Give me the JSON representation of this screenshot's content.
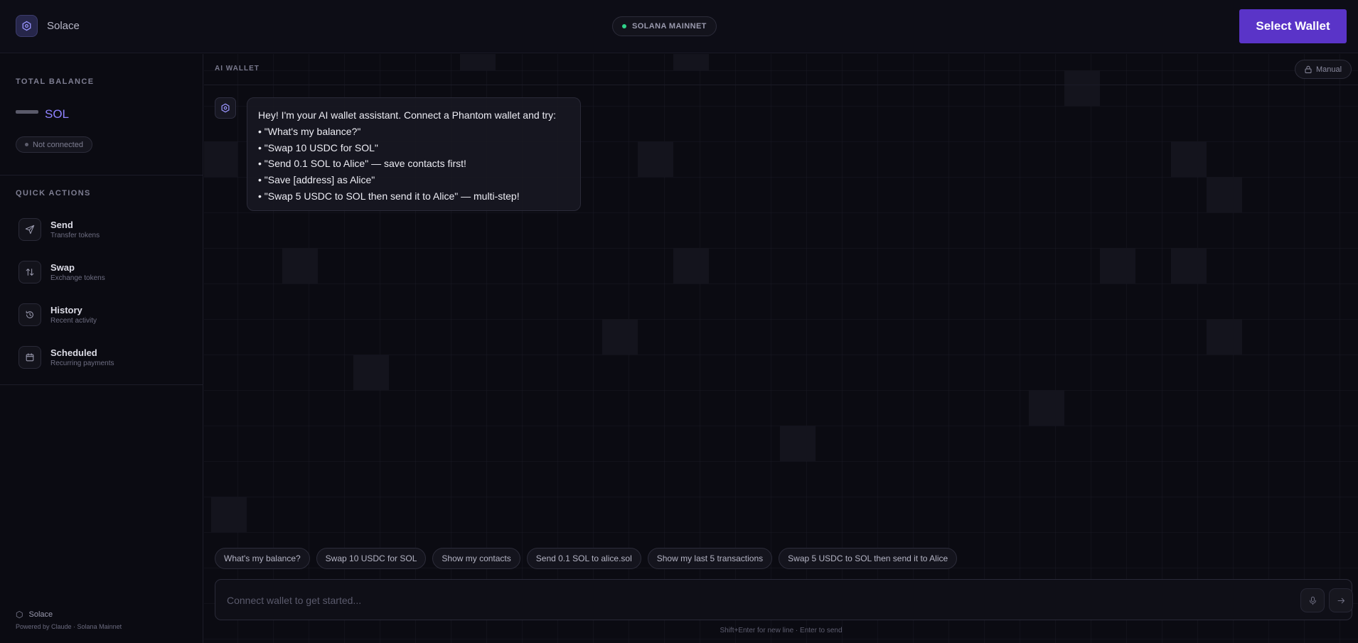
{
  "header": {
    "brand_name": "Solace",
    "network_label": "SOLANA MAINNET",
    "select_wallet_label": "Select Wallet"
  },
  "sidebar": {
    "total_balance_label": "TOTAL BALANCE",
    "balance_unit": "SOL",
    "connection_status": "Not connected",
    "quick_actions_label": "QUICK ACTIONS",
    "actions": [
      {
        "title": "Send",
        "subtitle": "Transfer tokens",
        "icon": "send-icon"
      },
      {
        "title": "Swap",
        "subtitle": "Exchange tokens",
        "icon": "swap-icon"
      },
      {
        "title": "History",
        "subtitle": "Recent activity",
        "icon": "history-icon"
      },
      {
        "title": "Scheduled",
        "subtitle": "Recurring payments",
        "icon": "calendar-icon"
      }
    ],
    "footer_brand": "Solace",
    "footer_sub": "Powered by Claude · Solana Mainnet"
  },
  "main": {
    "section_label": "AI WALLET",
    "mode_button": "Manual",
    "assistant_message": [
      "Hey! I'm your AI wallet assistant. Connect a Phantom wallet and try:",
      "• \"What's my balance?\"",
      "• \"Swap 10 USDC for SOL\"",
      "• \"Send 0.1 SOL to Alice\" — save contacts first!",
      "• \"Save [address] as Alice\"",
      "• \"Swap 5 USDC to SOL then send it to Alice\" — multi-step!"
    ],
    "suggestions": [
      "What's my balance?",
      "Swap 10 USDC for SOL",
      "Show my contacts",
      "Send 0.1 SOL to alice.sol",
      "Show my last 5 transactions",
      "Swap 5 USDC to SOL then send it to Alice"
    ],
    "input_placeholder": "Connect wallet to get started...",
    "input_hint": "Shift+Enter for new line · Enter to send"
  },
  "colors": {
    "accent": "#5a34c8",
    "accent_text": "#8f82ff",
    "status_online": "#2fd38a",
    "background": "#0b0b12"
  }
}
